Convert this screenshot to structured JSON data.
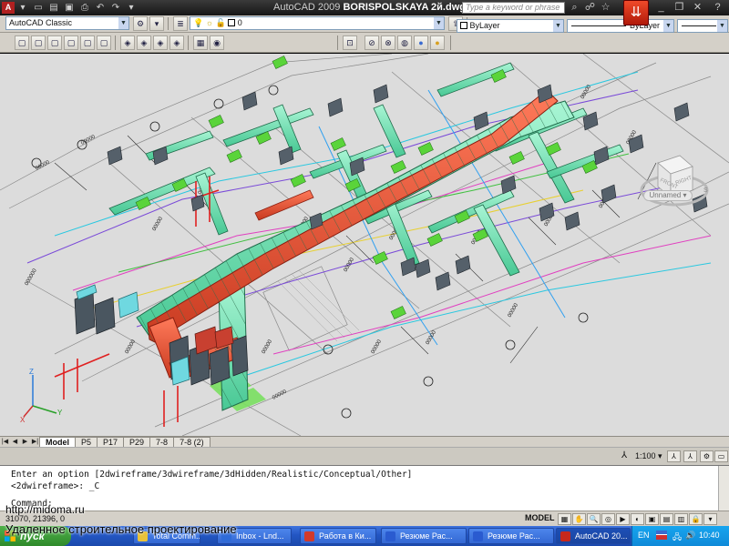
{
  "app": {
    "title_prefix": "AutoCAD 2009",
    "document": "BORISPOLSKAYA 2й.dwg",
    "search_placeholder": "Type a keyword or phrase"
  },
  "toolbar": {
    "workspace": "AutoCAD Classic",
    "layer_value": "0",
    "color_value": "ByLayer",
    "linetype_value": "ByLayer"
  },
  "viewport": {
    "viewcube_label": "Unnamed",
    "view_name_hint": "Unnamed"
  },
  "tabs": [
    {
      "label": "Model",
      "active": true
    },
    {
      "label": "P5"
    },
    {
      "label": "P17"
    },
    {
      "label": "P29"
    },
    {
      "label": "7-8"
    },
    {
      "label": "7-8 (2)"
    }
  ],
  "annotation": {
    "scale": "1:100"
  },
  "command": {
    "line1": "Enter an option [2dwireframe/3dwireframe/3dHidden/Realistic/Conceptual/Other]",
    "line2": "<2dwireframe>: _C",
    "line3": "Command:"
  },
  "status": {
    "coordinates": "31070, 21396, 0",
    "model_label": "MODEL"
  },
  "taskbar": {
    "start_label": "пуск",
    "tasks": [
      {
        "label": "Total Comm...",
        "color": "#e8c23a"
      },
      {
        "label": "Inbox - Lnd...",
        "color": "#2f6bd8"
      },
      {
        "label": "Работа в Ки...",
        "color": "#d23a2a"
      },
      {
        "label": "Резюме Рас...",
        "color": "#2a5bd0"
      },
      {
        "label": "Резюме Рас...",
        "color": "#2a5bd0"
      },
      {
        "label": "AutoCAD 20...",
        "color": "#c7281c"
      }
    ],
    "language": "EN",
    "clock": "10:40"
  },
  "watermark": {
    "url": "http://midoma.ru",
    "caption": "Удаленное строительное проектирование"
  },
  "colors": {
    "duct_main": "#e8563a",
    "duct_branch": "#6fe0b0",
    "fittings": "#5ad43a",
    "equipment": "#4a5660"
  }
}
